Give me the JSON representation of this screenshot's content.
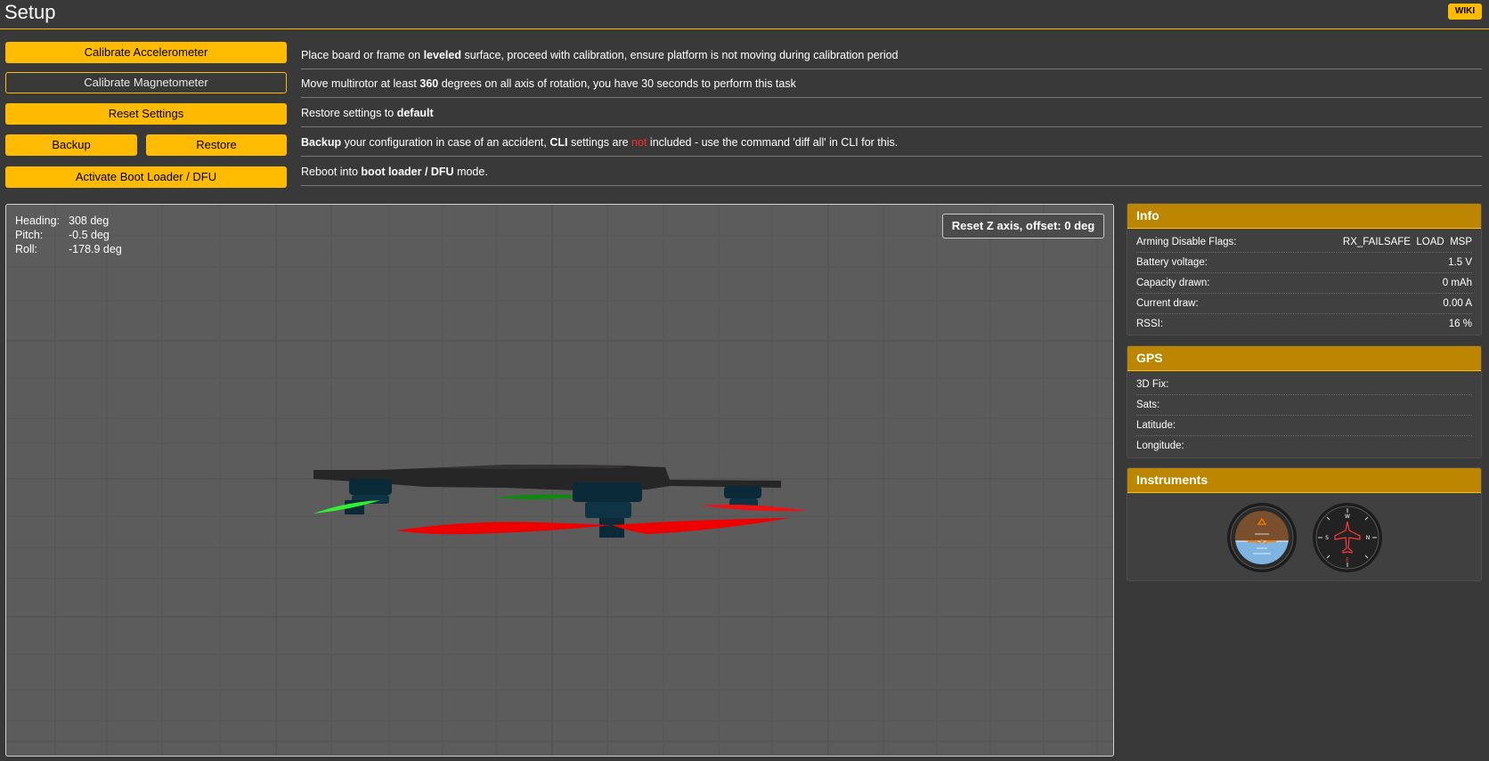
{
  "header": {
    "title": "Setup",
    "wiki_label": "WIKI"
  },
  "actions": [
    {
      "label": "Calibrate Accelerometer",
      "desc_parts": [
        "Place board or frame on ",
        "leveled",
        " surface, proceed with calibration, ensure platform is not moving during calibration period"
      ]
    },
    {
      "label": "Calibrate Magnetometer",
      "desc_parts": [
        "Move multirotor at least ",
        "360",
        " degrees on all axis of rotation, you have 30 seconds to perform this task"
      ]
    },
    {
      "label": "Reset Settings",
      "desc_parts": [
        "Restore settings to ",
        "default"
      ]
    },
    {
      "backup_label": "Backup",
      "restore_label": "Restore",
      "desc_parts": [
        "Backup",
        " your configuration in case of an accident, ",
        "CLI",
        " settings are ",
        "not",
        " included - use the command 'diff all' in CLI for this."
      ]
    },
    {
      "label": "Activate Boot Loader / DFU",
      "desc_parts": [
        "Reboot into ",
        "boot loader / DFU",
        " mode."
      ]
    }
  ],
  "attitude": {
    "heading_label": "Heading:",
    "heading_value": "308 deg",
    "pitch_label": "Pitch:",
    "pitch_value": "-0.5 deg",
    "roll_label": "Roll:",
    "roll_value": "-178.9 deg"
  },
  "reset_z_label": "Reset Z axis, offset: 0 deg",
  "info": {
    "title": "Info",
    "rows": [
      {
        "label": "Arming Disable Flags:",
        "value": "RX_FAILSAFE  LOAD  MSP"
      },
      {
        "label": "Battery voltage:",
        "value": "1.5 V"
      },
      {
        "label": "Capacity drawn:",
        "value": "0 mAh"
      },
      {
        "label": "Current draw:",
        "value": "0.00 A"
      },
      {
        "label": "RSSI:",
        "value": "16 %"
      }
    ]
  },
  "gps": {
    "title": "GPS",
    "rows": [
      {
        "label": "3D Fix:",
        "value": ""
      },
      {
        "label": "Sats:",
        "value": ""
      },
      {
        "label": "Latitude:",
        "value": ""
      },
      {
        "label": "Longitude:",
        "value": ""
      }
    ]
  },
  "instruments": {
    "title": "Instruments",
    "items": [
      "attitude-indicator-icon",
      "heading-indicator-icon"
    ]
  },
  "colors": {
    "accent": "#ffbb00",
    "panel_header": "#bd8600",
    "warning_text": "#ff2b2b",
    "prop_red": "#ff0000",
    "prop_green": "#22e022"
  }
}
